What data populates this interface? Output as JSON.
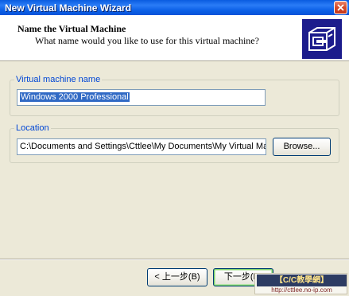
{
  "window": {
    "title": "New Virtual Machine Wizard"
  },
  "header": {
    "title": "Name the Virtual Machine",
    "subtitle": "What name would you like to use for this virtual machine?",
    "icon": "vmware-wizard-icon"
  },
  "name_group": {
    "label": "Virtual machine name",
    "value": "Windows 2000 Professional"
  },
  "location_group": {
    "label": "Location",
    "value": "C:\\Documents and Settings\\Cttlee\\My Documents\\My Virtual Ma",
    "browse_label": "Browse..."
  },
  "footer": {
    "back_label": "< 上一步(B)",
    "next_label": "下一步(N)",
    "watermark_line1": "【C/C教學網】",
    "watermark_line2": "http://cttlee.no-ip.com"
  },
  "colors": {
    "titlebar": "#0a5ce0",
    "group_label": "#0046d5",
    "selection": "#316ac5",
    "window_bg": "#ece9d8"
  }
}
